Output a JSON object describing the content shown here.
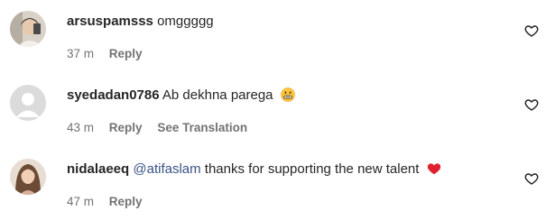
{
  "comments": [
    {
      "username": "arsuspamsss",
      "mention": "",
      "text": "omggggg",
      "time": "37 m",
      "reply_label": "Reply",
      "translation_label": "",
      "emoji": "",
      "like_icon": "heart-outline-icon"
    },
    {
      "username": "syedadan0786",
      "mention": "",
      "text": "Ab dekhna parega",
      "time": "43 m",
      "reply_label": "Reply",
      "translation_label": "See Translation",
      "emoji": "grimacing-face-emoji",
      "like_icon": "heart-outline-icon"
    },
    {
      "username": "nidalaeeq",
      "mention": "@atifaslam",
      "text": "thanks for supporting the new talent",
      "time": "47 m",
      "reply_label": "Reply",
      "translation_label": "",
      "emoji": "red-heart-emoji",
      "like_icon": "heart-outline-icon"
    }
  ],
  "colors": {
    "text": "#262626",
    "secondary": "#737373",
    "mention": "#385185",
    "heart_emoji": "#e0202e"
  }
}
